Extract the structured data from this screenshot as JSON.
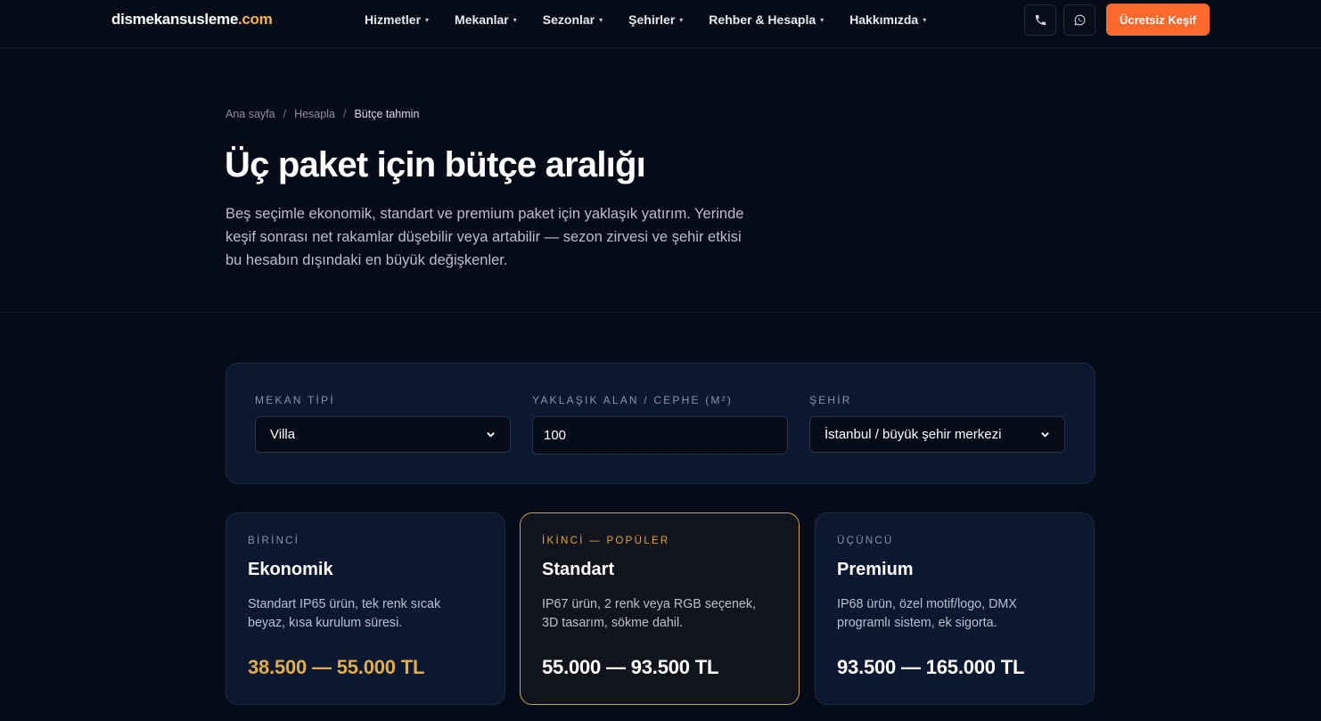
{
  "nav": {
    "logo_main": "dismekansusleme",
    "logo_tld": ".com",
    "menu": [
      {
        "label": "Hizmetler"
      },
      {
        "label": "Mekanlar"
      },
      {
        "label": "Sezonlar"
      },
      {
        "label": "Şehirler"
      },
      {
        "label": "Rehber & Hesapla"
      },
      {
        "label": "Hakkımızda"
      }
    ],
    "caret": "▾",
    "phone_icon": "phone-icon",
    "whatsapp_icon": "whatsapp-icon",
    "cta_label": "Ücretsiz Keşif"
  },
  "hero": {
    "breadcrumb": {
      "home": "Ana sayfa",
      "section": "Hesapla",
      "current": "Bütçe tahmin",
      "separator": "/"
    },
    "title": "Üç paket için bütçe aralığı",
    "lead": "Beş seçimle ekonomik, standart ve premium paket için yaklaşık yatırım. Yerinde keşif sonrası net rakamlar düşebilir veya artabilir — sezon zirvesi ve şehir etkisi bu hesabın dışındaki en büyük değişkenler."
  },
  "form": {
    "venue_type": {
      "label": "MEKAN TİPİ",
      "value": "Villa"
    },
    "area": {
      "label": "YAKLAŞIK ALAN / CEPHE (M²)",
      "value": "100"
    },
    "city": {
      "label": "ŞEHİR",
      "value": "İstanbul / büyük şehir merkezi"
    }
  },
  "packages": [
    {
      "tag": "BİRİNCİ",
      "name": "Ekonomik",
      "desc": "Standart IP65 ürün, tek renk sıcak beyaz, kısa kurulum süresi.",
      "price": "38.500 — 55.000 TL"
    },
    {
      "tag": "İKİNCİ — POPÜLER",
      "name": "Standart",
      "desc": "IP67 ürün, 2 renk veya RGB seçenek, 3D tasarım, sökme dahil.",
      "price": "55.000 — 93.500 TL"
    },
    {
      "tag": "ÜÇÜNCÜ",
      "name": "Premium",
      "desc": "IP68 ürün, özel motif/logo, DMX programlı sistem, ek sigorta.",
      "price": "93.500 — 165.000 TL"
    }
  ],
  "colors": {
    "background": "#050b17",
    "panel": "#0b1830",
    "accent_orange": "#ff6a2c",
    "accent_gold": "#e3ac4b"
  }
}
